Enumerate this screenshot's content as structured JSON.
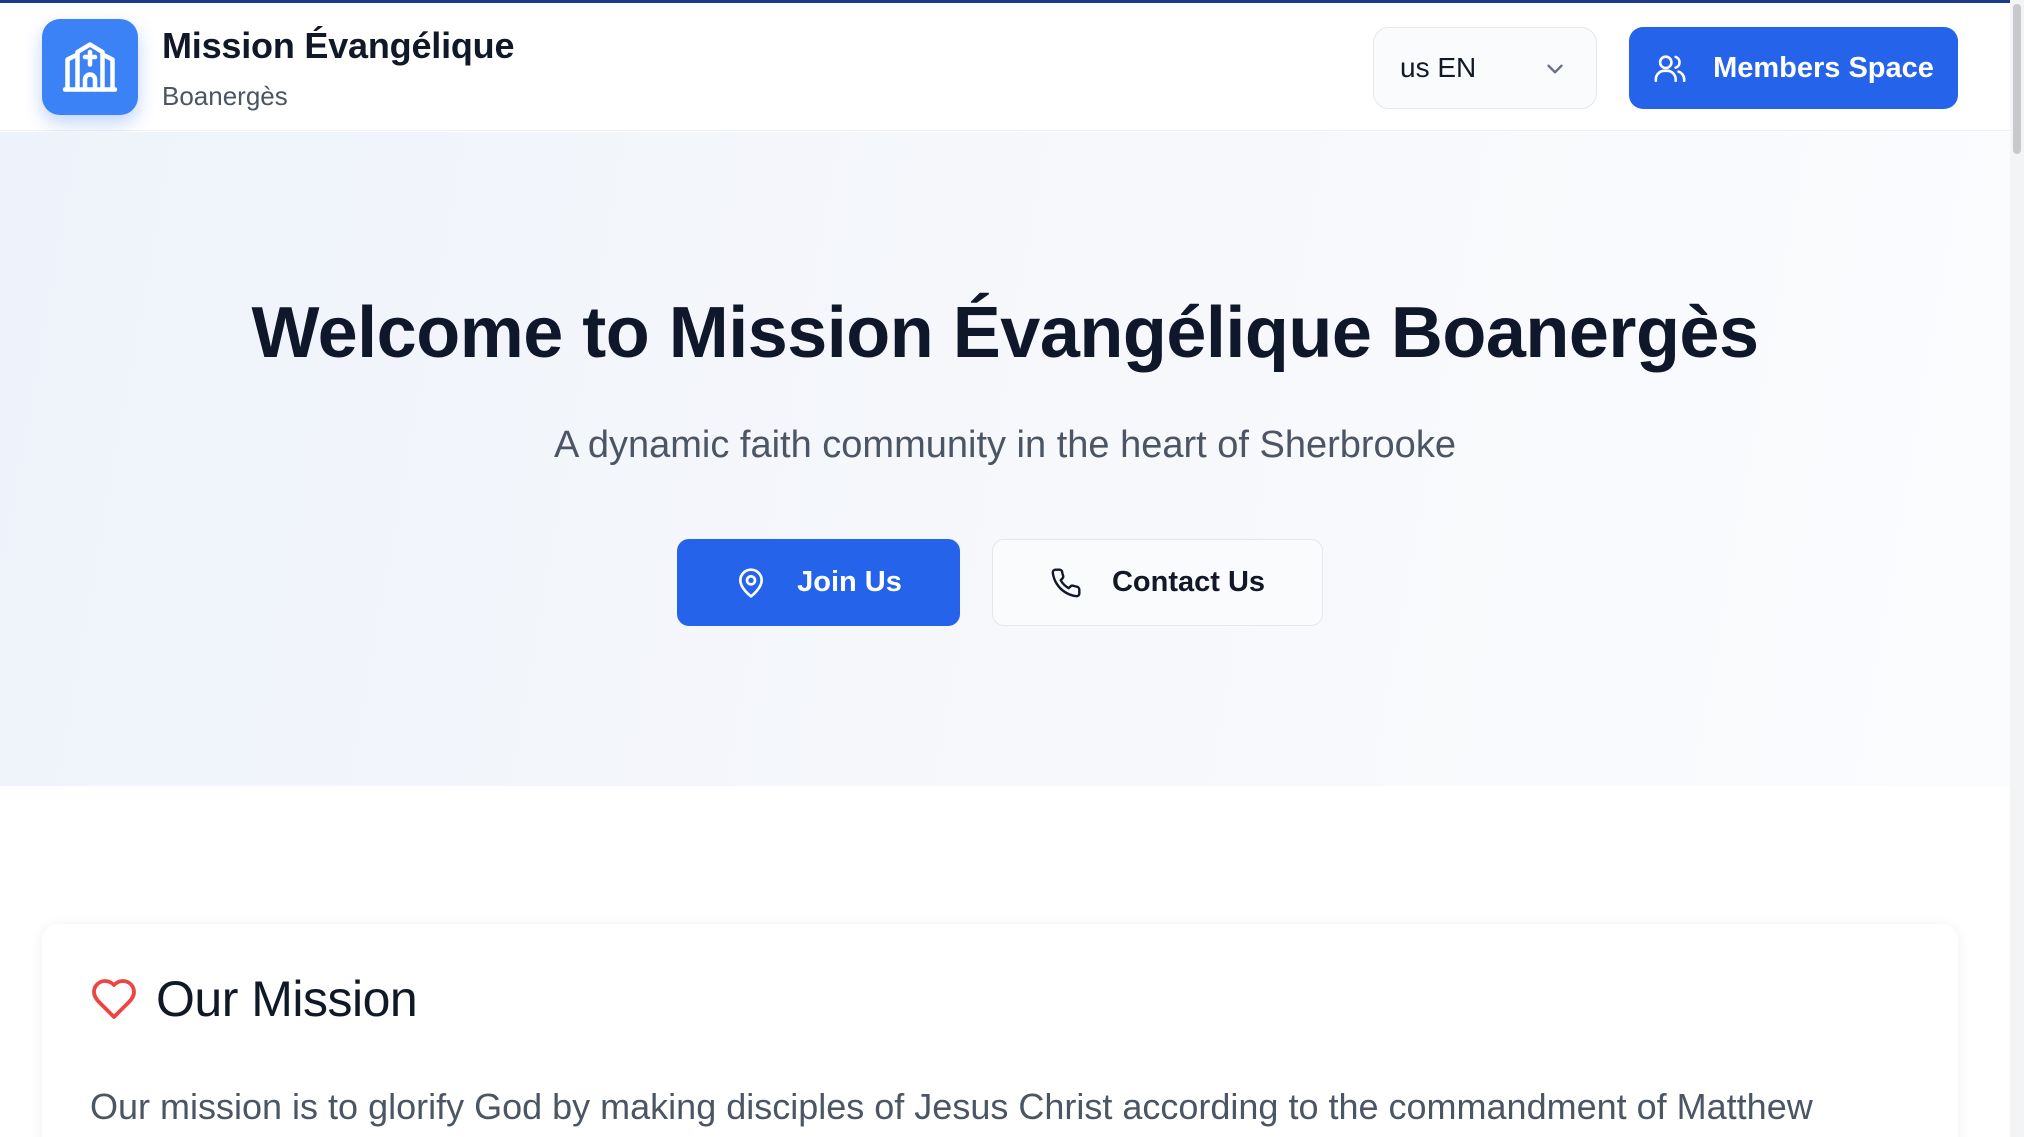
{
  "header": {
    "brand_title": "Mission Évangélique",
    "brand_subtitle": "Boanergès",
    "logo_icon": "church-icon",
    "language": {
      "selected": "us EN",
      "icon": "chevron-down-icon"
    },
    "members_button": {
      "label": "Members Space",
      "icon": "users-icon"
    }
  },
  "hero": {
    "title": "Welcome to Mission Évangélique Boanergès",
    "subtitle": "A dynamic faith community in the heart of Sherbrooke",
    "join_button": {
      "label": "Join Us",
      "icon": "map-pin-icon"
    },
    "contact_button": {
      "label": "Contact Us",
      "icon": "phone-icon"
    }
  },
  "mission": {
    "title": "Our Mission",
    "icon": "heart-icon",
    "text": "Our mission is to glorify God by making disciples of Jesus Christ according to the commandment of Matthew"
  },
  "colors": {
    "primary": "#2563eb",
    "logo_bg": "#3b82f6",
    "heart": "#ef4444",
    "hero_bg": "#eef3fb",
    "text_dark": "#111827",
    "text_muted": "#4b5563"
  }
}
